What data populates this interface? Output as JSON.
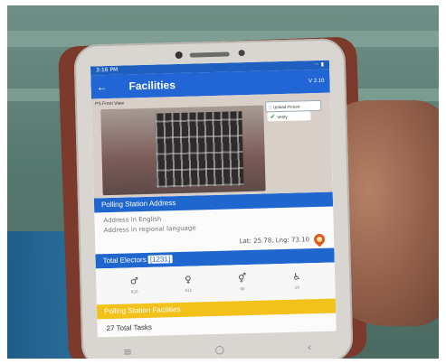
{
  "status": {
    "left": "3:16 PM",
    "right": "··· ▮"
  },
  "appbar": {
    "title": "Facilities",
    "right": "V 2.10"
  },
  "photo": {
    "label": "PS Front View",
    "upload_label": "Upload Picture",
    "verify_label": "Verify"
  },
  "address": {
    "section_title": "Polling Station Address",
    "english": "Address in English",
    "regional": "Address in regional language",
    "latlng": "Lat: 25.78, Lng: 73.10"
  },
  "electors": {
    "label": "Total Electors",
    "value": "[1231]"
  },
  "icon_row": [
    {
      "icon": "male-icon",
      "glyph": "♂",
      "label": "620"
    },
    {
      "icon": "female-icon",
      "glyph": "♀",
      "label": "611"
    },
    {
      "icon": "third-gender-icon",
      "glyph": "⚥",
      "label": "00"
    },
    {
      "icon": "disabled-icon",
      "glyph": "♿",
      "label": "10"
    }
  ],
  "facilities": {
    "section_title": "Polling Station Facilities",
    "tasks": "27 Total Tasks"
  },
  "nav": {
    "left": "≡",
    "center": "○",
    "right": "‹"
  },
  "colors": {
    "primary": "#2266d6",
    "accent": "#f3c21a",
    "pin": "#e1581c"
  }
}
